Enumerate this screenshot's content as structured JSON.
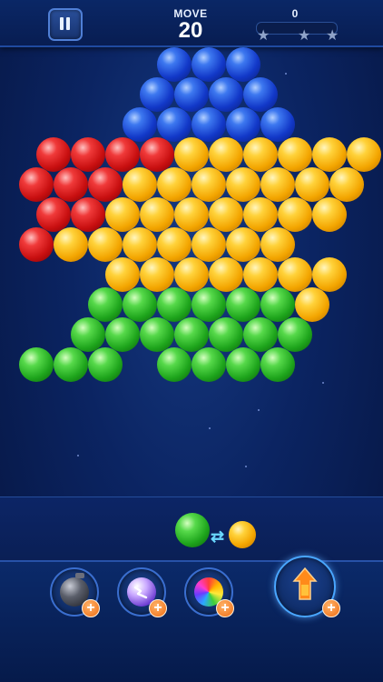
{
  "header": {
    "move_label": "MOVE",
    "moves_left": "20",
    "score": "0",
    "star_count": 3
  },
  "board": {
    "rows": [
      [
        "",
        "",
        "",
        "",
        "blue",
        "blue",
        "blue",
        "",
        "",
        ""
      ],
      [
        "",
        "",
        "",
        "blue",
        "blue",
        "blue",
        "blue",
        "",
        "",
        ""
      ],
      [
        "",
        "",
        "",
        "blue",
        "blue",
        "blue",
        "blue",
        "blue",
        "",
        ""
      ],
      [
        "red",
        "red",
        "red",
        "red",
        "yellow",
        "yellow",
        "yellow",
        "yellow",
        "yellow",
        "yellow"
      ],
      [
        "red",
        "red",
        "red",
        "yellow",
        "yellow",
        "yellow",
        "yellow",
        "yellow",
        "yellow",
        "yellow"
      ],
      [
        "red",
        "red",
        "yellow",
        "yellow",
        "yellow",
        "yellow",
        "yellow",
        "yellow",
        "yellow",
        ""
      ],
      [
        "red",
        "yellow",
        "yellow",
        "yellow",
        "yellow",
        "yellow",
        "yellow",
        "yellow",
        "",
        ""
      ],
      [
        "",
        "",
        "yellow",
        "yellow",
        "yellow",
        "yellow",
        "yellow",
        "yellow",
        "yellow",
        ""
      ],
      [
        "",
        "",
        "green",
        "green",
        "green",
        "green",
        "green",
        "green",
        "yellow",
        ""
      ],
      [
        "",
        "green",
        "green",
        "green",
        "green",
        "green",
        "green",
        "green",
        "",
        ""
      ],
      [
        "green",
        "green",
        "green",
        "",
        "green",
        "green",
        "green",
        "green",
        "",
        ""
      ]
    ]
  },
  "shooter": {
    "current_color": "green",
    "next_color": "yellow"
  },
  "boosters": [
    {
      "name": "bomb",
      "icon": "bomb-icon",
      "add_label": "+"
    },
    {
      "name": "lightning",
      "icon": "lightning-ball-icon",
      "add_label": "+"
    },
    {
      "name": "rainbow",
      "icon": "rainbow-ball-icon",
      "add_label": "+"
    },
    {
      "name": "rocket",
      "icon": "rocket-icon",
      "add_label": "+"
    }
  ],
  "colors": {
    "background": "#0b2462",
    "blue": "#1238c8",
    "yellow": "#f3a500",
    "red": "#c80f10",
    "green": "#1ea51c",
    "accent_orange": "#ef6b12"
  }
}
